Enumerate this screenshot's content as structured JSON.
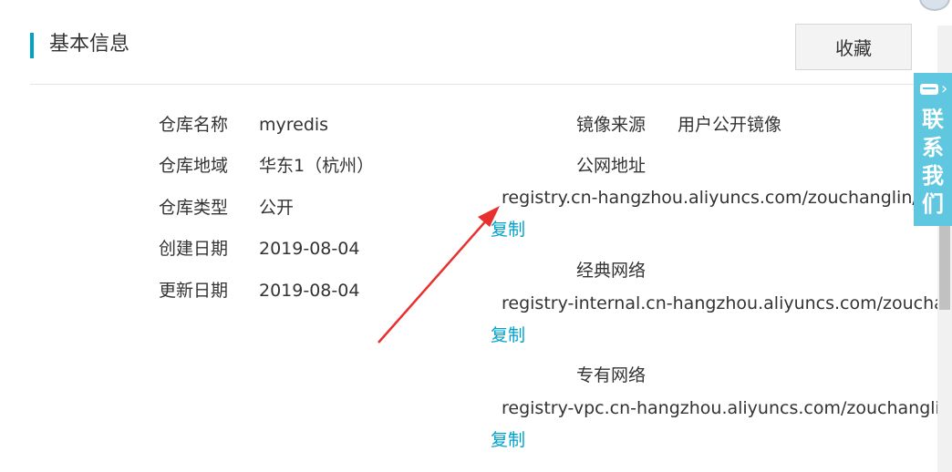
{
  "header": {
    "title": "基本信息",
    "favorite_label": "收藏"
  },
  "info_left": [
    {
      "label": "仓库名称",
      "value": "myredis"
    },
    {
      "label": "仓库地域",
      "value": "华东1（杭州）"
    },
    {
      "label": "仓库类型",
      "value": "公开"
    },
    {
      "label": "创建日期",
      "value": "2019-08-04"
    },
    {
      "label": "更新日期",
      "value": "2019-08-04"
    }
  ],
  "info_right": {
    "source_label": "镜像来源",
    "source_value": "用户公开镜像",
    "public": {
      "label": "公网地址",
      "url": "registry.cn-hangzhou.aliyuncs.com/zouchanglin/myredis",
      "copy": "复制"
    },
    "classic": {
      "label": "经典网络",
      "url": "registry-internal.cn-hangzhou.aliyuncs.com/zouchanglin/myredis",
      "copy": "复制"
    },
    "vpc": {
      "label": "专有网络",
      "url": "registry-vpc.cn-hangzhou.aliyuncs.com/zouchanglin/myredis",
      "copy": "复制"
    }
  },
  "contact_widget": {
    "text": [
      "联",
      "系",
      "我",
      "们"
    ],
    "icon": "chat-icon"
  },
  "colors": {
    "accent": "#00a2ca",
    "contact_bg": "#5fc7e0",
    "arrow": "#e8302f"
  }
}
